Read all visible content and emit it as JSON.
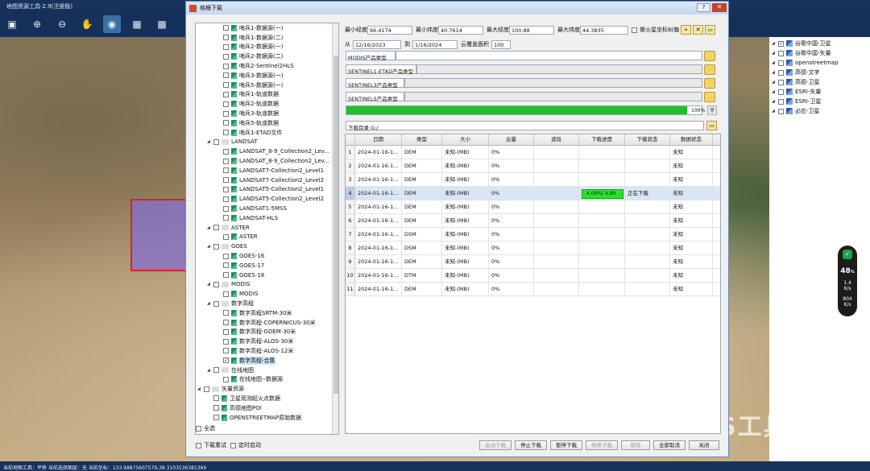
{
  "app": {
    "title": "地图资源工具-2.9(注册版)"
  },
  "toolbar": {
    "icons": [
      "save-icon",
      "zoom-in-icon",
      "zoom-out-icon",
      "pan-hand-icon",
      "locate-icon",
      "grid-a-icon",
      "grid-b-icon"
    ]
  },
  "dialog": {
    "title": "格栅下载",
    "help": "?",
    "close": "✕",
    "tree": [
      {
        "label": "哨兵1-数据源(一)",
        "level": 2,
        "leaf": true,
        "checked": false
      },
      {
        "label": "哨兵1-数据源(二)",
        "level": 2,
        "leaf": true,
        "checked": false
      },
      {
        "label": "哨兵2-数据源(一)",
        "level": 2,
        "leaf": true,
        "checked": false
      },
      {
        "label": "哨兵2-数据源(二)",
        "level": 2,
        "leaf": true,
        "checked": false
      },
      {
        "label": "哨兵2-Sentinel2HLS",
        "level": 2,
        "leaf": true,
        "checked": false
      },
      {
        "label": "哨兵3-数据源(一)",
        "level": 2,
        "leaf": true,
        "checked": false
      },
      {
        "label": "哨兵5-数据源(一)",
        "level": 2,
        "leaf": true,
        "checked": false
      },
      {
        "label": "哨兵1-轨道数据",
        "level": 2,
        "leaf": true,
        "checked": false
      },
      {
        "label": "哨兵2-轨道数据",
        "level": 2,
        "leaf": true,
        "checked": false
      },
      {
        "label": "哨兵3-轨道数据",
        "level": 2,
        "leaf": true,
        "checked": false
      },
      {
        "label": "哨兵5-轨道数据",
        "level": 2,
        "leaf": true,
        "checked": false
      },
      {
        "label": "哨兵1-ETAD文件",
        "level": 2,
        "leaf": true,
        "checked": false
      },
      {
        "label": "LANDSAT",
        "level": 1,
        "leaf": false,
        "checked": false
      },
      {
        "label": "LANDSAT_8-9_Collection2_Lev...",
        "level": 2,
        "leaf": true,
        "checked": false
      },
      {
        "label": "LANDSAT_8-9_Collection2_Lev...",
        "level": 2,
        "leaf": true,
        "checked": false
      },
      {
        "label": "LANDSAT7-Collection2_Level1",
        "level": 2,
        "leaf": true,
        "checked": false
      },
      {
        "label": "LANDSAT7-Collection2_Level2",
        "level": 2,
        "leaf": true,
        "checked": false
      },
      {
        "label": "LANDSAT5-Collection2_Level1",
        "level": 2,
        "leaf": true,
        "checked": false
      },
      {
        "label": "LANDSAT5-Collection2_Level2",
        "level": 2,
        "leaf": true,
        "checked": false
      },
      {
        "label": "LANDSAT1-5MSS",
        "level": 2,
        "leaf": true,
        "checked": false
      },
      {
        "label": "LANDSAT-HLS",
        "level": 2,
        "leaf": true,
        "checked": false
      },
      {
        "label": "ASTER",
        "level": 1,
        "leaf": false,
        "checked": false
      },
      {
        "label": "ASTER",
        "level": 2,
        "leaf": true,
        "checked": false
      },
      {
        "label": "GOES",
        "level": 1,
        "leaf": false,
        "checked": false
      },
      {
        "label": "GOES-16",
        "level": 2,
        "leaf": true,
        "checked": false
      },
      {
        "label": "GOES-17",
        "level": 2,
        "leaf": true,
        "checked": false
      },
      {
        "label": "GOES-18",
        "level": 2,
        "leaf": true,
        "checked": false
      },
      {
        "label": "MODIS",
        "level": 1,
        "leaf": false,
        "checked": false
      },
      {
        "label": "MODIS",
        "level": 2,
        "leaf": true,
        "checked": false
      },
      {
        "label": "数字高程",
        "level": 1,
        "leaf": false,
        "checked": false
      },
      {
        "label": "数字高程SRTM-30米",
        "level": 2,
        "leaf": true,
        "checked": false
      },
      {
        "label": "数字高程-COPERNICUS-30米",
        "level": 2,
        "leaf": true,
        "checked": false
      },
      {
        "label": "数字高程-GDEM-30米",
        "level": 2,
        "leaf": true,
        "checked": false
      },
      {
        "label": "数字高程-ALOS-30米",
        "level": 2,
        "leaf": true,
        "checked": false
      },
      {
        "label": "数字高程-ALOS-12米",
        "level": 2,
        "leaf": true,
        "checked": false
      },
      {
        "label": "数字高程-合集",
        "level": 2,
        "leaf": true,
        "checked": true
      },
      {
        "label": "在线地图",
        "level": 1,
        "leaf": false,
        "checked": false
      },
      {
        "label": "在线地图--数据源",
        "level": 2,
        "leaf": true,
        "checked": false
      },
      {
        "label": "矢量资源",
        "level": 0,
        "leaf": false,
        "checked": false
      },
      {
        "label": "卫星观测起火点数据",
        "level": 1,
        "leaf": true,
        "checked": false
      },
      {
        "label": "高德地图POI",
        "level": 1,
        "leaf": true,
        "checked": false
      },
      {
        "label": "OPENSTREETMAP原始数据",
        "level": 1,
        "leaf": true,
        "checked": false
      }
    ],
    "select_all": "全选",
    "redownload": "下载重试",
    "timed_start": "定时启动",
    "bounds": {
      "min_lon_label": "最小经度",
      "min_lon": "96.4174",
      "min_lat_label": "最小纬度",
      "min_lat": "40.7614",
      "max_lon_label": "最大经度",
      "max_lon": "100.88",
      "max_lat_label": "最大纬度",
      "max_lat": "44.3835",
      "mars_label": "做火星坐标纠偏"
    },
    "filter": {
      "from_label": "从",
      "from": "12/16/2023",
      "to_label": "到",
      "to": "1/16/2024",
      "cloud_label": "云覆盖面积",
      "cloud": "100"
    },
    "products": [
      {
        "label": "MODIS产品类型"
      },
      {
        "label": "SENTINEL1-ETAD产品类型"
      },
      {
        "label": "SENTINEL3产品类型"
      },
      {
        "label": "SENTINEL5产品类型"
      }
    ],
    "overall_progress": {
      "value": 1.0,
      "text": "100%"
    },
    "download_dir": {
      "label": "下载目录",
      "value": "G:/"
    },
    "table": {
      "headers": [
        "",
        "日期",
        "类型",
        "大小",
        "云量",
        "波段",
        "下载进度",
        "下载状态",
        "数据状态"
      ],
      "rows": [
        {
          "n": "1",
          "date": "2024-01-16-1...",
          "type": "DEM",
          "size": "未知-(MB)",
          "cloud": "0%",
          "band": "",
          "progress": "",
          "status": "",
          "data": "未知"
        },
        {
          "n": "2",
          "date": "2024-01-16-1...",
          "type": "DEM",
          "size": "未知-(MB)",
          "cloud": "0%",
          "band": "",
          "progress": "",
          "status": "",
          "data": "未知"
        },
        {
          "n": "3",
          "date": "2024-01-16-1...",
          "type": "DEM",
          "size": "未知-(MB)",
          "cloud": "0%",
          "band": "",
          "progress": "",
          "status": "",
          "data": "未知"
        },
        {
          "n": "4",
          "date": "2024-01-16-1...",
          "type": "DEM",
          "size": "未知-(MB)",
          "cloud": "0%",
          "band": "",
          "progress": "4.09%/     4.89",
          "status": "正在下载",
          "data": "未知"
        },
        {
          "n": "5",
          "date": "2024-01-16-1...",
          "type": "DEM",
          "size": "未知-(MB)",
          "cloud": "0%",
          "band": "",
          "progress": "",
          "status": "",
          "data": "未知"
        },
        {
          "n": "6",
          "date": "2024-01-16-1...",
          "type": "DEM",
          "size": "未知-(MB)",
          "cloud": "0%",
          "band": "",
          "progress": "",
          "status": "",
          "data": "未知"
        },
        {
          "n": "7",
          "date": "2024-01-16-1...",
          "type": "DSM",
          "size": "未知-(MB)",
          "cloud": "0%",
          "band": "",
          "progress": "",
          "status": "",
          "data": "未知"
        },
        {
          "n": "8",
          "date": "2024-01-16-1...",
          "type": "DSM",
          "size": "未知-(MB)",
          "cloud": "0%",
          "band": "",
          "progress": "",
          "status": "",
          "data": "未知"
        },
        {
          "n": "9",
          "date": "2024-01-16-1...",
          "type": "DEM",
          "size": "未知-(MB)",
          "cloud": "0%",
          "band": "",
          "progress": "",
          "status": "",
          "data": "未知"
        },
        {
          "n": "10",
          "date": "2024-01-16-1...",
          "type": "DTM",
          "size": "未知-(MB)",
          "cloud": "0%",
          "band": "",
          "progress": "",
          "status": "",
          "data": "未知"
        },
        {
          "n": "11",
          "date": "2024-01-16-1...",
          "type": "DEM",
          "size": "未知-(MB)",
          "cloud": "0%",
          "band": "",
          "progress": "",
          "status": "",
          "data": "未知"
        }
      ]
    },
    "buttons": {
      "start": "启动下载",
      "stop": "停止下载",
      "pause": "暂停下载",
      "resume": "继续下载",
      "remove": "移除",
      "cancel_all": "全部取消",
      "close": "关闭"
    }
  },
  "layers": [
    {
      "label": "谷歌中国-卫星",
      "checked": true
    },
    {
      "label": "谷歌中国-矢量",
      "checked": false
    },
    {
      "label": "openstreetmap",
      "checked": false
    },
    {
      "label": "高德-文字",
      "checked": false
    },
    {
      "label": "高德-卫星",
      "checked": false
    },
    {
      "label": "ESRI-矢量",
      "checked": false
    },
    {
      "label": "ESRI-卫星",
      "checked": false
    },
    {
      "label": "必应-卫星",
      "checked": false
    }
  ],
  "widget": {
    "percent": "48",
    "unit": "%",
    "up": "1.4",
    "up_unit": "K/s",
    "down": "804",
    "down_unit": "K/s"
  },
  "watermark": "公众号 · GIS工具",
  "status": {
    "text": "当前地图工具：平移  当前选择图层：无  当前坐标：133.98875607579,38.3103536381369"
  }
}
